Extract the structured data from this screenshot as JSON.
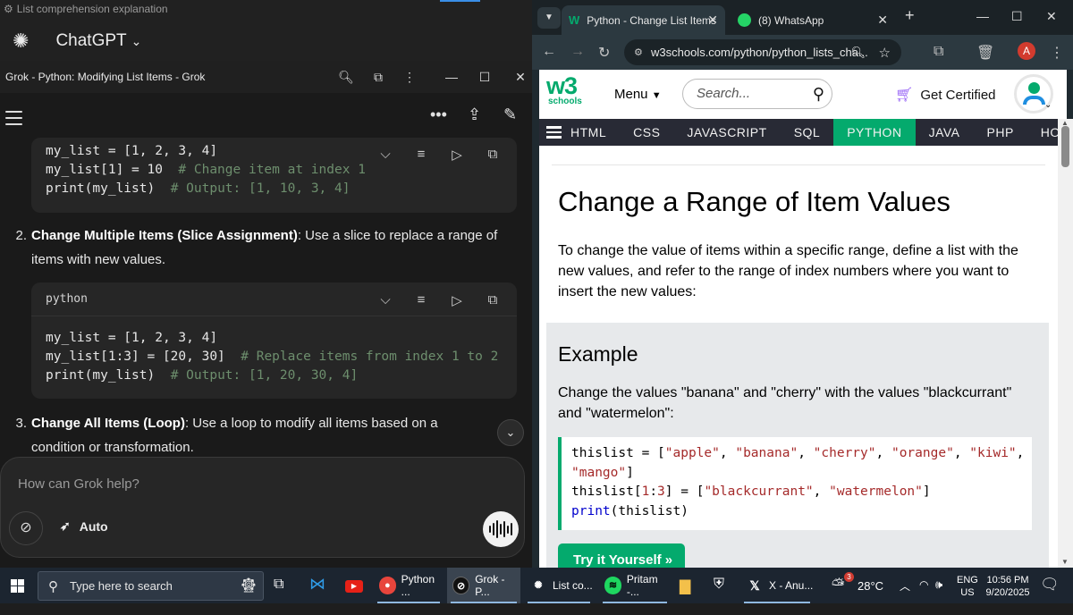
{
  "chatgpt": {
    "window_title": "List comprehension explanation",
    "brand": "ChatGPT",
    "caret": "⌄"
  },
  "grok": {
    "window_title": "Grok - Python: Modifying List Items - Grok",
    "code1": {
      "lines": [
        {
          "code": "my_list = [1, 2, 3, 4]",
          "comment": ""
        },
        {
          "code": "my_list[1] = 10  ",
          "comment": "# Change item at index 1"
        },
        {
          "code": "print(my_list)  ",
          "comment": "# Output: [1, 10, 3, 4]"
        }
      ]
    },
    "item2": {
      "num": "2.",
      "bold": "Change Multiple Items (Slice Assignment)",
      "text": ": Use a slice to replace a range of items with new values."
    },
    "code2": {
      "lang": "python",
      "lines": [
        {
          "code": "my_list = [1, 2, 3, 4]",
          "comment": ""
        },
        {
          "code": "my_list[1:3] = [20, 30]  ",
          "comment": "# Replace items from index 1 to 2"
        },
        {
          "code": "print(my_list)  ",
          "comment": "# Output: [1, 20, 30, 4]"
        }
      ]
    },
    "item3": {
      "num": "3.",
      "bold": "Change All Items (Loop)",
      "text": ": Use a loop to modify all items based on a condition or transformation."
    },
    "composer": {
      "placeholder": "How can Grok help?",
      "mode_label": "Auto"
    }
  },
  "chrome": {
    "tabs": [
      {
        "title": "Python - Change List Items",
        "icon": "w3schools-favicon",
        "active": true
      },
      {
        "title": "(8) WhatsApp",
        "icon": "whatsapp-icon",
        "active": false
      }
    ],
    "url": "w3schools.com/python/python_lists_cha...",
    "profile_initial": "A"
  },
  "w3": {
    "logo_main": "w3",
    "logo_sub": "schools",
    "menu_label": "Menu",
    "search_placeholder": "Search...",
    "cert_label": "Get Certified",
    "nav_items": [
      "HTML",
      "CSS",
      "JAVASCRIPT",
      "SQL",
      "PYTHON",
      "JAVA",
      "PHP",
      "HOW"
    ],
    "active_nav": "PYTHON",
    "heading": "Change a Range of Item Values",
    "intro": "To change the value of items within a specific range, define a list with the new values, and refer to the range of index numbers where you want to insert the new values:",
    "example_title": "Example",
    "example_text": "Change the values \"banana\" and \"cherry\" with the values \"blackcurrant\" and \"watermelon\":",
    "try_button": "Try it Yourself »"
  },
  "taskbar": {
    "search_placeholder": "Type here to search",
    "apps": [
      {
        "label": "Python ...",
        "icon": "chrome-icon"
      },
      {
        "label": "Grok - P...",
        "icon": "grok-icon"
      },
      {
        "label": "List co...",
        "icon": "chatgpt-icon"
      },
      {
        "label": "Pritam -...",
        "icon": "spotify-icon"
      },
      {
        "label": "X - Anu...",
        "icon": "x-icon"
      }
    ],
    "weather_temp": "28°C",
    "weather_badge": "3",
    "lang_top": "ENG",
    "lang_bottom": "US",
    "time": "10:56 PM",
    "date": "9/20/2025"
  },
  "colors": {
    "w3_green": "#04aa6d",
    "w3_nav_bg": "#282a35",
    "grok_bg": "#1a1a1a",
    "code_bg": "#262626",
    "taskbar_bg": "#1c2530"
  }
}
